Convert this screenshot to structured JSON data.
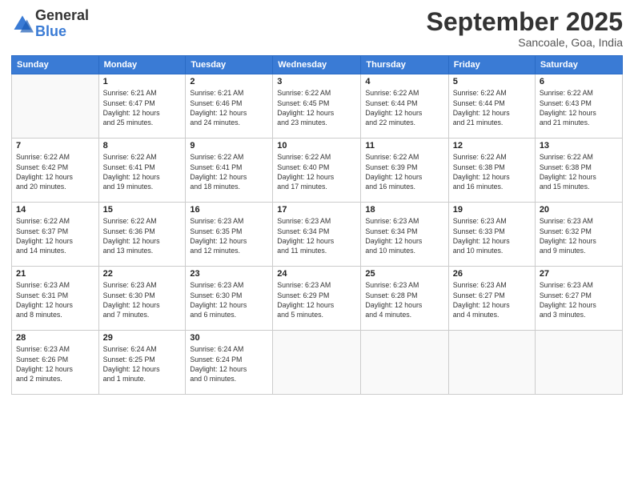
{
  "logo": {
    "general": "General",
    "blue": "Blue"
  },
  "header": {
    "month": "September 2025",
    "location": "Sancoale, Goa, India"
  },
  "weekdays": [
    "Sunday",
    "Monday",
    "Tuesday",
    "Wednesday",
    "Thursday",
    "Friday",
    "Saturday"
  ],
  "weeks": [
    [
      {
        "day": "",
        "info": ""
      },
      {
        "day": "1",
        "info": "Sunrise: 6:21 AM\nSunset: 6:47 PM\nDaylight: 12 hours\nand 25 minutes."
      },
      {
        "day": "2",
        "info": "Sunrise: 6:21 AM\nSunset: 6:46 PM\nDaylight: 12 hours\nand 24 minutes."
      },
      {
        "day": "3",
        "info": "Sunrise: 6:22 AM\nSunset: 6:45 PM\nDaylight: 12 hours\nand 23 minutes."
      },
      {
        "day": "4",
        "info": "Sunrise: 6:22 AM\nSunset: 6:44 PM\nDaylight: 12 hours\nand 22 minutes."
      },
      {
        "day": "5",
        "info": "Sunrise: 6:22 AM\nSunset: 6:44 PM\nDaylight: 12 hours\nand 21 minutes."
      },
      {
        "day": "6",
        "info": "Sunrise: 6:22 AM\nSunset: 6:43 PM\nDaylight: 12 hours\nand 21 minutes."
      }
    ],
    [
      {
        "day": "7",
        "info": "Sunrise: 6:22 AM\nSunset: 6:42 PM\nDaylight: 12 hours\nand 20 minutes."
      },
      {
        "day": "8",
        "info": "Sunrise: 6:22 AM\nSunset: 6:41 PM\nDaylight: 12 hours\nand 19 minutes."
      },
      {
        "day": "9",
        "info": "Sunrise: 6:22 AM\nSunset: 6:41 PM\nDaylight: 12 hours\nand 18 minutes."
      },
      {
        "day": "10",
        "info": "Sunrise: 6:22 AM\nSunset: 6:40 PM\nDaylight: 12 hours\nand 17 minutes."
      },
      {
        "day": "11",
        "info": "Sunrise: 6:22 AM\nSunset: 6:39 PM\nDaylight: 12 hours\nand 16 minutes."
      },
      {
        "day": "12",
        "info": "Sunrise: 6:22 AM\nSunset: 6:38 PM\nDaylight: 12 hours\nand 16 minutes."
      },
      {
        "day": "13",
        "info": "Sunrise: 6:22 AM\nSunset: 6:38 PM\nDaylight: 12 hours\nand 15 minutes."
      }
    ],
    [
      {
        "day": "14",
        "info": "Sunrise: 6:22 AM\nSunset: 6:37 PM\nDaylight: 12 hours\nand 14 minutes."
      },
      {
        "day": "15",
        "info": "Sunrise: 6:22 AM\nSunset: 6:36 PM\nDaylight: 12 hours\nand 13 minutes."
      },
      {
        "day": "16",
        "info": "Sunrise: 6:23 AM\nSunset: 6:35 PM\nDaylight: 12 hours\nand 12 minutes."
      },
      {
        "day": "17",
        "info": "Sunrise: 6:23 AM\nSunset: 6:34 PM\nDaylight: 12 hours\nand 11 minutes."
      },
      {
        "day": "18",
        "info": "Sunrise: 6:23 AM\nSunset: 6:34 PM\nDaylight: 12 hours\nand 10 minutes."
      },
      {
        "day": "19",
        "info": "Sunrise: 6:23 AM\nSunset: 6:33 PM\nDaylight: 12 hours\nand 10 minutes."
      },
      {
        "day": "20",
        "info": "Sunrise: 6:23 AM\nSunset: 6:32 PM\nDaylight: 12 hours\nand 9 minutes."
      }
    ],
    [
      {
        "day": "21",
        "info": "Sunrise: 6:23 AM\nSunset: 6:31 PM\nDaylight: 12 hours\nand 8 minutes."
      },
      {
        "day": "22",
        "info": "Sunrise: 6:23 AM\nSunset: 6:30 PM\nDaylight: 12 hours\nand 7 minutes."
      },
      {
        "day": "23",
        "info": "Sunrise: 6:23 AM\nSunset: 6:30 PM\nDaylight: 12 hours\nand 6 minutes."
      },
      {
        "day": "24",
        "info": "Sunrise: 6:23 AM\nSunset: 6:29 PM\nDaylight: 12 hours\nand 5 minutes."
      },
      {
        "day": "25",
        "info": "Sunrise: 6:23 AM\nSunset: 6:28 PM\nDaylight: 12 hours\nand 4 minutes."
      },
      {
        "day": "26",
        "info": "Sunrise: 6:23 AM\nSunset: 6:27 PM\nDaylight: 12 hours\nand 4 minutes."
      },
      {
        "day": "27",
        "info": "Sunrise: 6:23 AM\nSunset: 6:27 PM\nDaylight: 12 hours\nand 3 minutes."
      }
    ],
    [
      {
        "day": "28",
        "info": "Sunrise: 6:23 AM\nSunset: 6:26 PM\nDaylight: 12 hours\nand 2 minutes."
      },
      {
        "day": "29",
        "info": "Sunrise: 6:24 AM\nSunset: 6:25 PM\nDaylight: 12 hours\nand 1 minute."
      },
      {
        "day": "30",
        "info": "Sunrise: 6:24 AM\nSunset: 6:24 PM\nDaylight: 12 hours\nand 0 minutes."
      },
      {
        "day": "",
        "info": ""
      },
      {
        "day": "",
        "info": ""
      },
      {
        "day": "",
        "info": ""
      },
      {
        "day": "",
        "info": ""
      }
    ]
  ]
}
